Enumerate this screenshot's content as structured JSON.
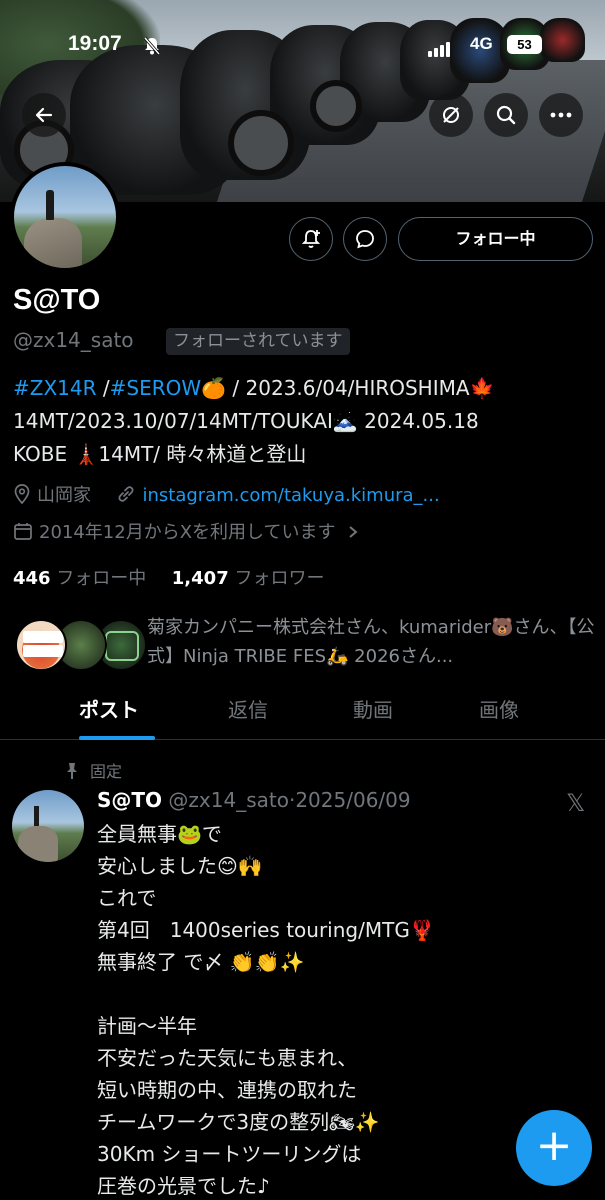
{
  "status_bar": {
    "time": "19:07",
    "network": "4G",
    "battery": "53",
    "silent_icon": "bell-slash-icon"
  },
  "banner": {
    "back_icon": "back-arrow-icon",
    "action_icons": [
      "sync-disabled-icon",
      "search-icon",
      "more-icon"
    ]
  },
  "profile": {
    "name": "S@TO",
    "handle": "@zx14_sato",
    "follows_you": "フォローされています",
    "follow_button": "フォロー中",
    "bio": {
      "tag1": "#ZX14R",
      "sep1": " /",
      "tag2": "#SEROW",
      "rest1": "🍊 / 2023.6/04/HIROSHIMA🍁",
      "line2": "14MT/2023.10/07/14MT/TOUKAI🗻 2024.05.18",
      "line3": "KOBE 🗼14MT/ 時々林道と登山"
    },
    "location": "山岡家",
    "website": "instagram.com/takuya.kimura_...",
    "joined": "2014年12月からXを利用しています",
    "following_count": "446",
    "following_label": "フォロー中",
    "followers_count": "1,407",
    "followers_label": "フォロワー",
    "mutuals": "菊家カンパニー株式会社さん、kumarider🐻さん、【公式】Ninja TRIBE FES🛵 2026さん..."
  },
  "tabs": [
    "ポスト",
    "返信",
    "動画",
    "画像"
  ],
  "post": {
    "pinned_label": "固定",
    "author_name": "S@TO",
    "author_handle": "@zx14_sato",
    "date": "2025/06/09",
    "text": "全員無事🐸で\n安心しました😊🙌\nこれで\n第4回　1400series touring/MTG🦞\n無事終了 で〆 👏👏✨\n\n計画〜半年\n不安だった天気にも恵まれ、\n短い時期の中、連携の取れた\nチームワークで3度の整列🏍✨\n30Km ショートツーリングは\n圧巻の光景でした♪"
  },
  "fab": {
    "label": "+"
  },
  "colors": {
    "accent": "#1d9bf0",
    "background": "#000000",
    "muted": "#71767b"
  }
}
